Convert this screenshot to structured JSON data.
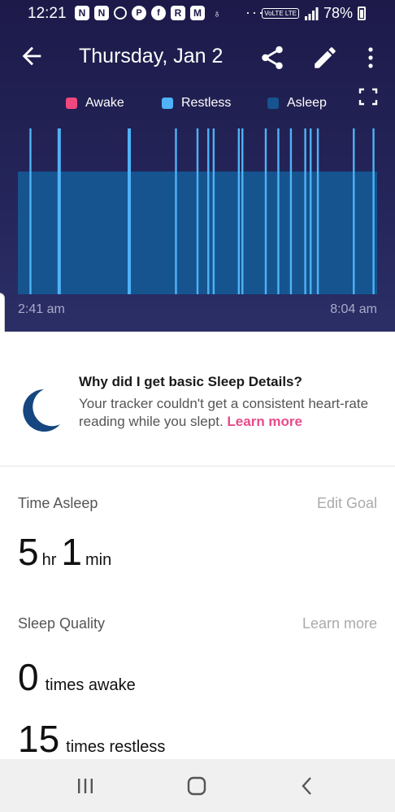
{
  "status_bar": {
    "time": "12:21",
    "icons": [
      "nest-icon",
      "nest-icon",
      "circle-icon",
      "pinterest-icon",
      "facebook-icon",
      "r-icon",
      "mail-icon",
      "fitness-icon"
    ],
    "overflow": "···",
    "network": "VoLTE LTE",
    "battery": "78%"
  },
  "app_bar": {
    "title": "Thursday, Jan 2"
  },
  "legend": [
    {
      "label": "Awake",
      "color": "#f0487e"
    },
    {
      "label": "Restless",
      "color": "#4fb2f7"
    },
    {
      "label": "Asleep",
      "color": "#15548f"
    }
  ],
  "chart_data": {
    "type": "area",
    "x_start": "2:41 am",
    "x_end": "8:04 am",
    "asleep_level_fraction": 0.74,
    "restless_spikes_fraction_of_night": [
      0.035,
      0.115,
      0.31,
      0.44,
      0.5,
      0.53,
      0.545,
      0.615,
      0.625,
      0.69,
      0.725,
      0.76,
      0.8,
      0.815,
      0.835,
      0.935,
      0.99
    ],
    "colors": {
      "asleep": "#15548f",
      "restless": "#4fb2f7"
    }
  },
  "info": {
    "title": "Why did I get basic Sleep Details?",
    "body": "Your tracker couldn't get a consistent heart-rate reading while you slept.",
    "link": "Learn more"
  },
  "time_asleep": {
    "label": "Time Asleep",
    "action": "Edit Goal",
    "hours": "5",
    "hours_unit": "hr",
    "minutes": "1",
    "minutes_unit": "min"
  },
  "sleep_quality": {
    "label": "Sleep Quality",
    "action": "Learn more",
    "awake_count": "0",
    "awake_label": "times awake",
    "restless_count": "15",
    "restless_label": "times restless"
  }
}
